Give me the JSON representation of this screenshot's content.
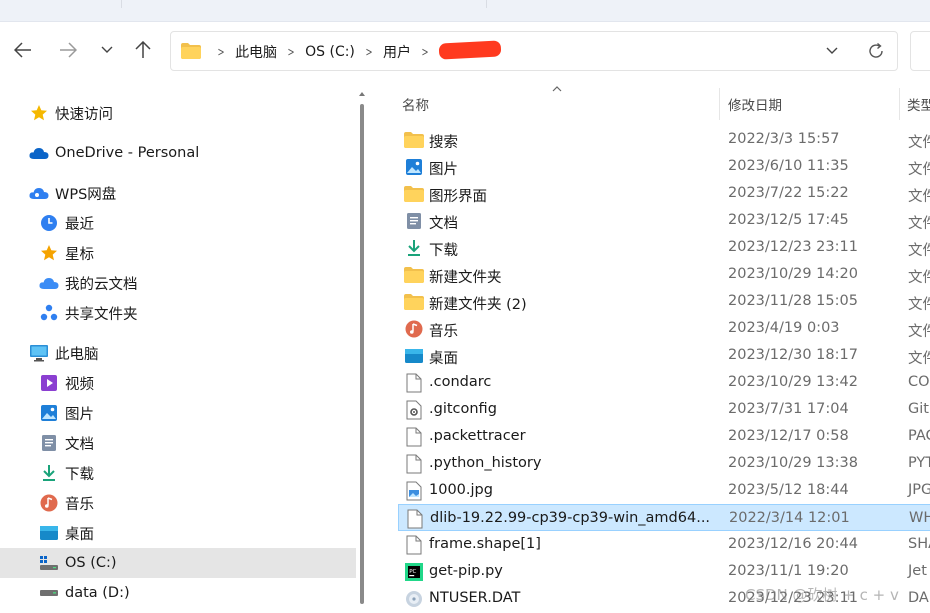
{
  "colors": {
    "accent": "#0067c0",
    "selected_row": "#cce8ff",
    "selected_side": "#e5e5e5",
    "redaction": "#ff3a1f"
  },
  "toolbar": {
    "back_icon": "arrow-left-icon",
    "forward_icon": "arrow-right-icon",
    "recent_icon": "chevron-down-icon",
    "up_icon": "arrow-up-icon"
  },
  "address": {
    "crumbs": [
      "此电脑",
      "OS (C:)",
      "用户"
    ],
    "redacted": true
  },
  "sidebar": {
    "items": [
      {
        "label": "快速访问",
        "icon": "star-icon"
      },
      {
        "label": "OneDrive - Personal",
        "icon": "cloud-icon"
      },
      {
        "label": "WPS网盘",
        "icon": "wps-cloud-icon"
      },
      {
        "label": "最近",
        "icon": "clock-icon"
      },
      {
        "label": "星标",
        "icon": "star-icon"
      },
      {
        "label": "我的云文档",
        "icon": "cloud-doc-icon"
      },
      {
        "label": "共享文件夹",
        "icon": "share-icon"
      },
      {
        "label": "此电脑",
        "icon": "computer-icon"
      },
      {
        "label": "视频",
        "icon": "video-icon"
      },
      {
        "label": "图片",
        "icon": "picture-icon"
      },
      {
        "label": "文档",
        "icon": "document-icon"
      },
      {
        "label": "下载",
        "icon": "download-icon"
      },
      {
        "label": "音乐",
        "icon": "music-icon"
      },
      {
        "label": "桌面",
        "icon": "desktop-icon"
      },
      {
        "label": "OS (C:)",
        "icon": "drive-icon"
      },
      {
        "label": "data (D:)",
        "icon": "drive-icon"
      }
    ]
  },
  "columns": {
    "name": "名称",
    "date": "修改日期",
    "type": "类型"
  },
  "files": [
    {
      "name": "搜索",
      "date": "2022/3/3 15:57",
      "type": "文件",
      "icon": "folder-icon"
    },
    {
      "name": "图片",
      "date": "2023/6/10 11:35",
      "type": "文件",
      "icon": "picture-icon"
    },
    {
      "name": "图形界面",
      "date": "2023/7/22 15:22",
      "type": "文件",
      "icon": "folder-icon"
    },
    {
      "name": "文档",
      "date": "2023/12/5 17:45",
      "type": "文件",
      "icon": "document-icon"
    },
    {
      "name": "下载",
      "date": "2023/12/23 23:11",
      "type": "文件",
      "icon": "download-icon"
    },
    {
      "name": "新建文件夹",
      "date": "2023/10/29 14:20",
      "type": "文件",
      "icon": "folder-icon"
    },
    {
      "name": "新建文件夹 (2)",
      "date": "2023/11/28 15:05",
      "type": "文件",
      "icon": "folder-icon"
    },
    {
      "name": "音乐",
      "date": "2023/4/19 0:03",
      "type": "文件",
      "icon": "music-icon"
    },
    {
      "name": "桌面",
      "date": "2023/12/30 18:17",
      "type": "文件",
      "icon": "desktop-icon"
    },
    {
      "name": ".condarc",
      "date": "2023/10/29 13:42",
      "type": "CO",
      "icon": "file-icon"
    },
    {
      "name": ".gitconfig",
      "date": "2023/7/31 17:04",
      "type": "Git",
      "icon": "gear-file-icon"
    },
    {
      "name": ".packettracer",
      "date": "2023/12/17 0:58",
      "type": "PAC",
      "icon": "file-icon"
    },
    {
      "name": ".python_history",
      "date": "2023/10/29 13:38",
      "type": "PYT",
      "icon": "file-icon"
    },
    {
      "name": "1000.jpg",
      "date": "2023/5/12 18:44",
      "type": "JPG",
      "icon": "image-file-icon"
    },
    {
      "name": "dlib-19.22.99-cp39-cp39-win_amd64...",
      "date": "2022/3/14 12:01",
      "type": "WH",
      "icon": "file-icon",
      "selected": true
    },
    {
      "name": "frame.shape[1]",
      "date": "2023/12/16 20:44",
      "type": "SHA",
      "icon": "file-icon"
    },
    {
      "name": "get-pip.py",
      "date": "2023/11/1 19:20",
      "type": "Jet",
      "icon": "pycharm-icon"
    },
    {
      "name": "NTUSER.DAT",
      "date": "2023/12/23 23:11",
      "type": "DA",
      "icon": "system-file-icon"
    }
  ],
  "watermark": "CSDN @砍树 + c + v"
}
